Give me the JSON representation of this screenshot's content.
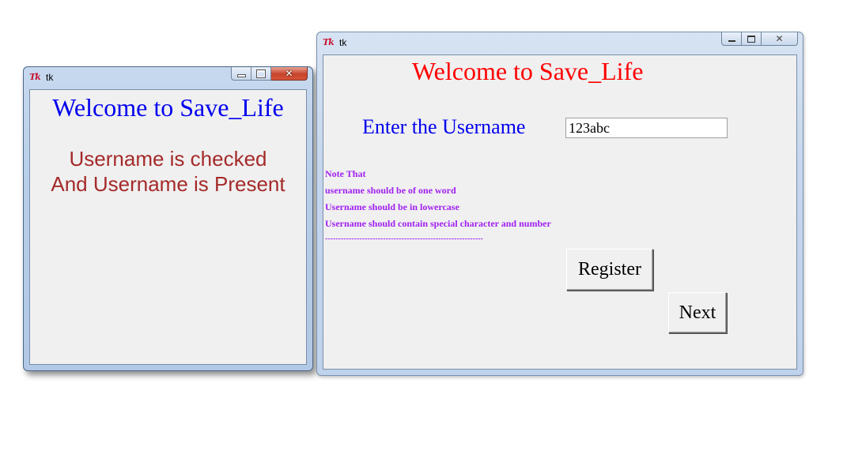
{
  "window_left": {
    "title": "tk",
    "logo_text": "Tk",
    "heading": "Welcome to Save_Life",
    "message_line1": "Username is checked",
    "message_line2": "And Username is Present"
  },
  "window_right": {
    "title": "tk",
    "logo_text": "Tk",
    "heading": "Welcome to Save_Life",
    "username_label": "Enter the Username",
    "username_value": "123abc",
    "notes": [
      "Note That",
      "username should be  of one word",
      "Username should be in lowercase",
      "Username should contain special character and number",
      "------------------------------------------------------------"
    ],
    "register_label": "Register",
    "next_label": "Next"
  },
  "icons": {
    "minimize": "minimize-icon",
    "maximize": "maximize-icon",
    "close": "close-icon",
    "app": "tk-logo-icon"
  },
  "colors": {
    "left_heading": "#0000ee",
    "left_message": "#a52a2a",
    "right_heading": "#ff0000",
    "label": "#0000ee",
    "notes": "#a020f0"
  }
}
